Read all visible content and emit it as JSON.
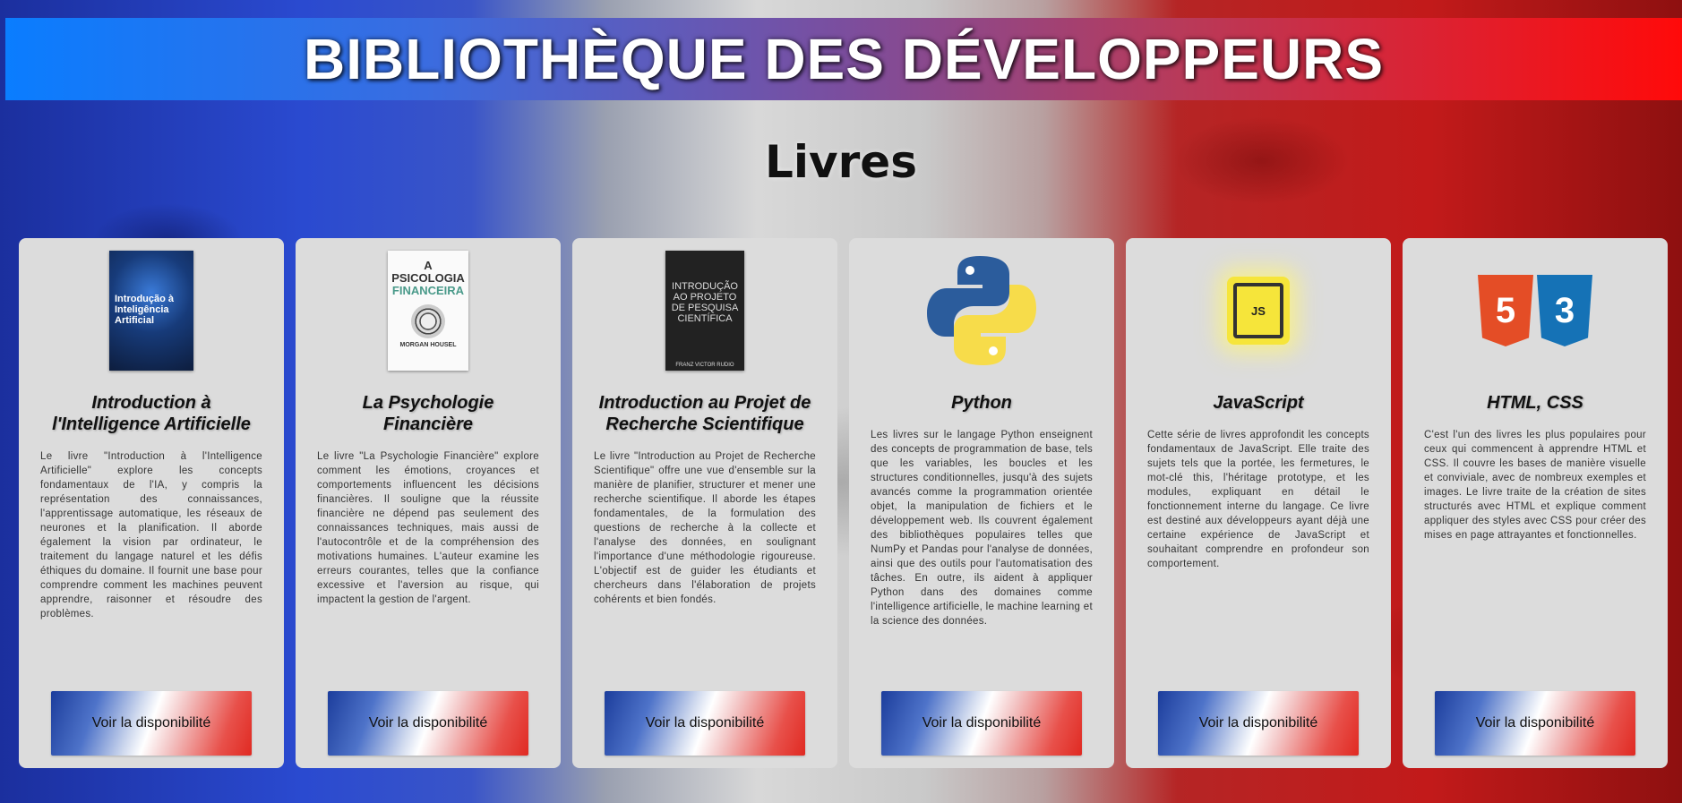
{
  "header": {
    "title": "BIBLIOTHÈQUE DES DÉVELOPPEURS"
  },
  "section": {
    "title": "Livres"
  },
  "books": [
    {
      "title": "Introduction à l'Intelligence Artificielle",
      "description": "Le livre \"Introduction à l'Intelligence Artificielle\" explore les concepts fondamentaux de l'IA, y compris la représentation des connaissances, l'apprentissage automatique, les réseaux de neurones et la planification. Il aborde également la vision par ordinateur, le traitement du langage naturel et les défis éthiques du domaine. Il fournit une base pour comprendre comment les machines peuvent apprendre, raisonner et résoudre des problèmes.",
      "cover_text": "Introdução à Inteligência Artificial",
      "button": "Voir la disponibilité"
    },
    {
      "title": "La Psychologie Financière",
      "description": "Le livre \"La Psychologie Financière\" explore comment les émotions, croyances et comportements influencent les décisions financières. Il souligne que la réussite financière ne dépend pas seulement des connaissances techniques, mais aussi de l'autocontrôle et de la compréhension des motivations humaines. L'auteur examine les erreurs courantes, telles que la confiance excessive et l'aversion au risque, qui impactent la gestion de l'argent.",
      "cover_text_1": "A PSICOLOGIA",
      "cover_text_2": "FINANCEIRA",
      "cover_author": "MORGAN HOUSEL",
      "button": "Voir la disponibilité"
    },
    {
      "title": "Introduction au Projet de Recherche Scientifique",
      "description": "Le livre \"Introduction au Projet de Recherche Scientifique\" offre une vue d'ensemble sur la manière de planifier, structurer et mener une recherche scientifique. Il aborde les étapes fondamentales, de la formulation des questions de recherche à la collecte et l'analyse des données, en soulignant l'importance d'une méthodologie rigoureuse. L'objectif est de guider les étudiants et chercheurs dans l'élaboration de projets cohérents et bien fondés.",
      "cover_text": "INTRODUÇÃO AO PROJETO DE PESQUISA CIENTÍFICA",
      "cover_author": "FRANZ VICTOR RUDIO",
      "button": "Voir la disponibilité"
    },
    {
      "title": "Python",
      "description": "Les livres sur le langage Python enseignent des concepts de programmation de base, tels que les variables, les boucles et les structures conditionnelles, jusqu'à des sujets avancés comme la programmation orientée objet, la manipulation de fichiers et le développement web. Ils couvrent également des bibliothèques populaires telles que NumPy et Pandas pour l'analyse de données, ainsi que des outils pour l'automatisation des tâches. En outre, ils aident à appliquer Python dans des domaines comme l'intelligence artificielle, le machine learning et la science des données.",
      "button": "Voir la disponibilité"
    },
    {
      "title": "JavaScript",
      "description": "Cette série de livres approfondit les concepts fondamentaux de JavaScript. Elle traite des sujets tels que la portée, les fermetures, le mot-clé this, l'héritage prototype, et les modules, expliquant en détail le fonctionnement interne du langage. Ce livre est destiné aux développeurs ayant déjà une certaine expérience de JavaScript et souhaitant comprendre en profondeur son comportement.",
      "logo_text": "JS",
      "button": "Voir la disponibilité"
    },
    {
      "title": "HTML, CSS",
      "description": "C'est l'un des livres les plus populaires pour ceux qui commencent à apprendre HTML et CSS. Il couvre les bases de manière visuelle et conviviale, avec de nombreux exemples et images. Le livre traite de la création de sites structurés avec HTML et explique comment appliquer des styles avec CSS pour créer des mises en page attrayantes et fonctionnelles.",
      "logo_text_1": "5",
      "logo_text_2": "3",
      "button": "Voir la disponibilité"
    }
  ],
  "colors": {
    "banner_left": "#0a7dff",
    "banner_right": "#ff0a0a",
    "card_bg": "#dcdcdc"
  }
}
